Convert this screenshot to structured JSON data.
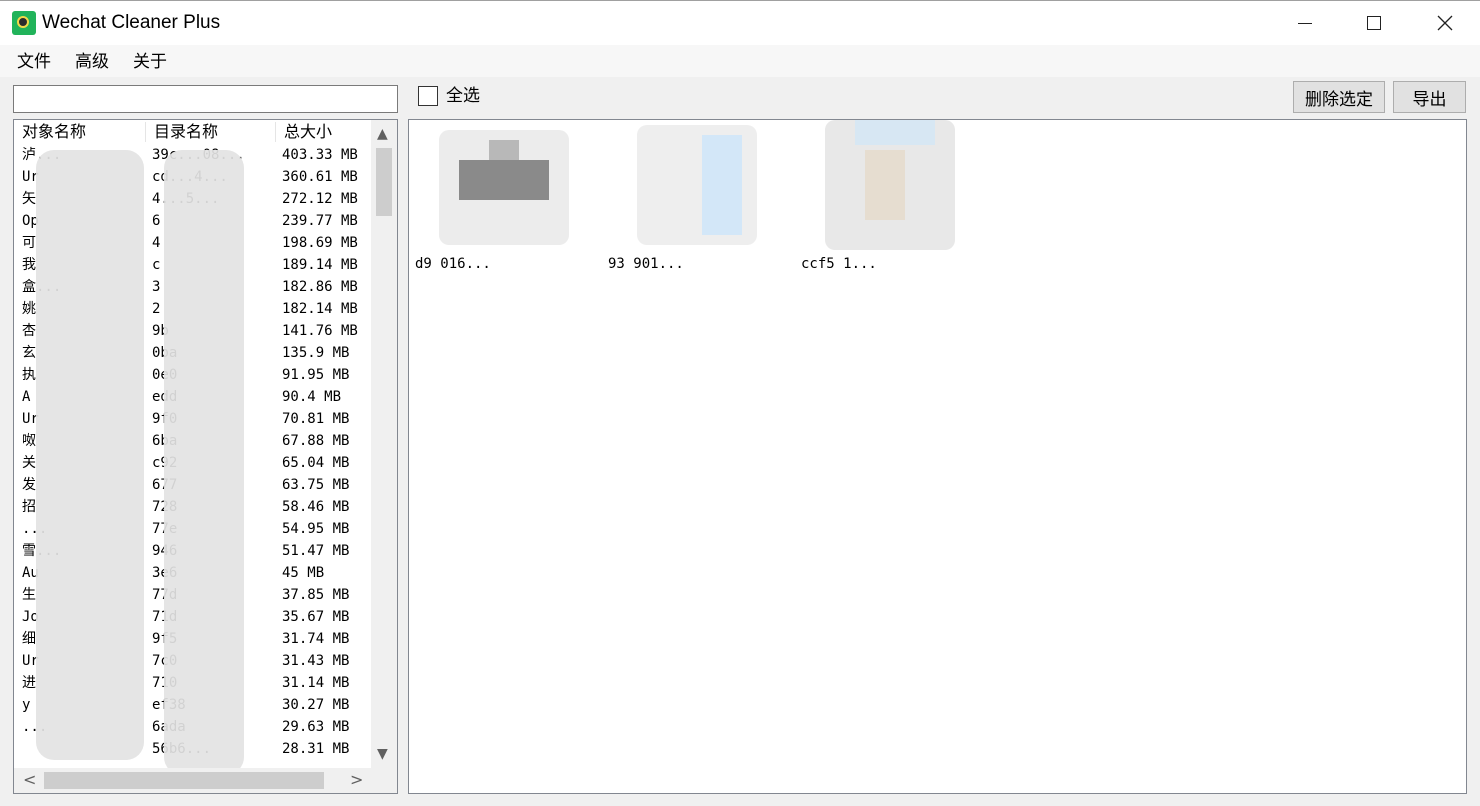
{
  "window": {
    "title": "Wechat Cleaner Plus",
    "controls": {
      "minimize": "—",
      "maximize": "☐",
      "close": "✕"
    }
  },
  "menu": {
    "items": [
      "文件",
      "高级",
      "关于"
    ]
  },
  "search": {
    "value": "",
    "placeholder": ""
  },
  "list": {
    "columns": [
      "对象名称",
      "目录名称",
      "总大小"
    ],
    "rows": [
      {
        "name": "泸...",
        "dir": "39c...08...",
        "size": "403.33 MB"
      },
      {
        "name": "Ur",
        "dir": "cd...4...",
        "size": "360.61 MB"
      },
      {
        "name": "矢",
        "dir": "4...5...",
        "size": "272.12 MB"
      },
      {
        "name": "Op",
        "dir": "6",
        "size": "239.77 MB"
      },
      {
        "name": "可",
        "dir": "4",
        "size": "198.69 MB"
      },
      {
        "name": "我",
        "dir": "c",
        "size": "189.14 MB"
      },
      {
        "name": "盒...",
        "dir": "3",
        "size": "182.86 MB"
      },
      {
        "name": "姚",
        "dir": "2",
        "size": "182.14 MB"
      },
      {
        "name": "杏",
        "dir": "9b",
        "size": "141.76 MB"
      },
      {
        "name": "玄",
        "dir": "0ba",
        "size": "135.9 MB"
      },
      {
        "name": "执",
        "dir": "0e0",
        "size": "91.95 MB"
      },
      {
        "name": "A",
        "dir": "edd",
        "size": "90.4 MB"
      },
      {
        "name": "Ur",
        "dir": "9f0",
        "size": "70.81 MB"
      },
      {
        "name": "呶",
        "dir": "6ba",
        "size": "67.88 MB"
      },
      {
        "name": "关",
        "dir": "c92",
        "size": "65.04 MB"
      },
      {
        "name": "发",
        "dir": "677",
        "size": "63.75 MB"
      },
      {
        "name": "招",
        "dir": "728",
        "size": "58.46 MB"
      },
      {
        "name": "...",
        "dir": "77e",
        "size": "54.95 MB"
      },
      {
        "name": "雪...",
        "dir": "946",
        "size": "51.47 MB"
      },
      {
        "name": "Au",
        "dir": "3e6",
        "size": "45 MB"
      },
      {
        "name": "生",
        "dir": "77d",
        "size": "37.85 MB"
      },
      {
        "name": "Jo",
        "dir": "71d",
        "size": "35.67 MB"
      },
      {
        "name": "细",
        "dir": "9f5",
        "size": "31.74 MB"
      },
      {
        "name": "Ur",
        "dir": "7c0",
        "size": "31.43 MB"
      },
      {
        "name": "进",
        "dir": "710",
        "size": "31.14 MB"
      },
      {
        "name": "y",
        "dir": "ef38",
        "size": "30.27 MB"
      },
      {
        "name": "...",
        "dir": "6ada",
        "size": "29.63 MB"
      },
      {
        "name": "",
        "dir": "56b6...",
        "size": "28.31 MB"
      }
    ]
  },
  "toolbar": {
    "select_all_label": "全选",
    "select_all_checked": false,
    "delete_label": "删除选定",
    "export_label": "导出"
  },
  "thumbnails": [
    {
      "caption": "d9          016..."
    },
    {
      "caption": "93          901..."
    },
    {
      "caption": "ccf5         1..."
    }
  ],
  "icons": {
    "app": "wechat-cleaner-app-icon",
    "scroll_up": "▲",
    "scroll_down": "▼",
    "scroll_left": "<",
    "scroll_right": ">"
  }
}
